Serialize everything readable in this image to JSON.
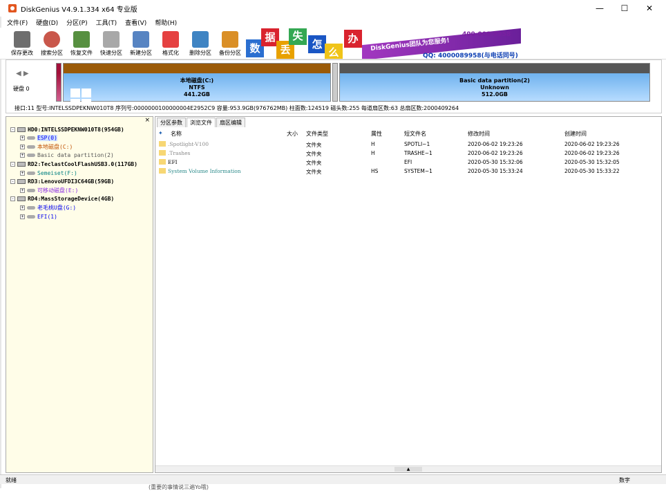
{
  "window": {
    "title": "DiskGenius V4.9.1.334 x64 专业版",
    "minimize": "—",
    "maximize": "☐",
    "close": "✕"
  },
  "menu": [
    "文件(F)",
    "硬盘(D)",
    "分区(P)",
    "工具(T)",
    "查看(V)",
    "帮助(H)"
  ],
  "toolbar": [
    {
      "label": "保存更改",
      "icon": "save-icon",
      "color": "#555"
    },
    {
      "label": "搜索分区",
      "icon": "search-icon",
      "color": "#c0392b"
    },
    {
      "label": "恢复文件",
      "icon": "recover-file-icon",
      "color": "#3a7d1e"
    },
    {
      "label": "快速分区",
      "icon": "quick-partition-icon",
      "color": "#999"
    },
    {
      "label": "新建分区",
      "icon": "new-partition-icon",
      "color": "#3a6fb7"
    },
    {
      "label": "格式化",
      "icon": "format-icon",
      "color": "#e02020"
    },
    {
      "label": "删除分区",
      "icon": "delete-partition-icon",
      "color": "#1d6fb8"
    },
    {
      "label": "备份分区",
      "icon": "backup-partition-icon",
      "color": "#d47b00"
    }
  ],
  "banner": {
    "chars": [
      {
        "c": "数",
        "bg": "#2b6fd0"
      },
      {
        "c": "据",
        "bg": "#d9232e"
      },
      {
        "c": "丢",
        "bg": "#e8a100"
      },
      {
        "c": "失",
        "bg": "#34a853"
      },
      {
        "c": "怎",
        "bg": "#1a56c4"
      },
      {
        "c": "么",
        "bg": "#f0c419"
      },
      {
        "c": "办",
        "bg": "#d9232e"
      }
    ],
    "slogan": "DiskGenius团队为您服务!",
    "phone": "400-008-9958",
    "qq": "QQ: 4000089958(与电话同号)"
  },
  "disk": {
    "nav_left": "◀",
    "nav_right": "▶",
    "label": "硬盘 0",
    "partitions": [
      {
        "name": "本地磁盘(C:)",
        "fs": "NTFS",
        "size": "441.2GB"
      },
      {
        "name": "Basic data partition(2)",
        "fs": "Unknown",
        "size": "512.0GB"
      }
    ],
    "info": "接口:11   型号:INTELSSDPEKNW010T8   序列号:0000000100000004E2952C9   容量:953.9GB(976762MB)   柱面数:124519   磁头数:255   每道扇区数:63   总扇区数:2000409264"
  },
  "tree": {
    "close": "×",
    "rows": [
      {
        "text": "HD0:INTELSSDPEKNW010T8(954GB)",
        "type": "disk",
        "level": 0,
        "color": "#000",
        "exp": "-"
      },
      {
        "text": "ESP(0)",
        "type": "part",
        "level": 1,
        "color": "#0000ee",
        "bg": "#cfe0ff",
        "exp": "+"
      },
      {
        "text": "本地磁盘(C:)",
        "type": "part",
        "level": 1,
        "color": "#c05000",
        "exp": "+"
      },
      {
        "text": "Basic data partition(2)",
        "type": "part",
        "level": 1,
        "color": "#555",
        "exp": "+"
      },
      {
        "text": "RD2:TeclastCoolFlashUSB3.0(117GB)",
        "type": "disk",
        "level": 0,
        "color": "#000",
        "exp": "-"
      },
      {
        "text": "Semeiset(F:)",
        "type": "part",
        "level": 1,
        "color": "#008080",
        "exp": "+"
      },
      {
        "text": "RD3:LenovoUFDI3C64GB(59GB)",
        "type": "disk",
        "level": 0,
        "color": "#000",
        "exp": "-"
      },
      {
        "text": "可移动磁盘(E:)",
        "type": "part",
        "level": 1,
        "color": "#8a2be2",
        "exp": "+"
      },
      {
        "text": "RD4:MassStorageDevice(4GB)",
        "type": "disk",
        "level": 0,
        "color": "#000",
        "exp": "-"
      },
      {
        "text": "老毛桃U盘(G:)",
        "type": "part",
        "level": 1,
        "color": "#0000ee",
        "exp": "+"
      },
      {
        "text": "EFI(1)",
        "type": "part",
        "level": 1,
        "color": "#0000ee",
        "exp": "+"
      }
    ]
  },
  "tabs": [
    "分区参数",
    "浏览文件",
    "扇区编辑"
  ],
  "file_columns": [
    "名称",
    "大小",
    "文件类型",
    "属性",
    "短文件名",
    "修改时间",
    "创建时间"
  ],
  "files": [
    {
      "name": ".Spotlight-V100",
      "size": "",
      "type": "文件夹",
      "attr": "H",
      "short": "SPOTLI~1",
      "mtime": "2020-06-02 19:23:26",
      "ctime": "2020-06-02 19:23:26",
      "color": "#888"
    },
    {
      "name": ".Trashes",
      "size": "",
      "type": "文件夹",
      "attr": "H",
      "short": "TRASHE~1",
      "mtime": "2020-06-02 19:23:26",
      "ctime": "2020-06-02 19:23:26",
      "color": "#888"
    },
    {
      "name": "EFI",
      "size": "",
      "type": "文件夹",
      "attr": "",
      "short": "EFI",
      "mtime": "2020-05-30 15:32:06",
      "ctime": "2020-05-30 15:32:05",
      "color": "#000"
    },
    {
      "name": "System Volume Information",
      "size": "",
      "type": "文件夹",
      "attr": "HS",
      "short": "SYSTEM~1",
      "mtime": "2020-05-30 15:33:24",
      "ctime": "2020-05-30 15:33:22",
      "color": "#2a8a8a"
    }
  ],
  "status": {
    "left": "就绪",
    "right": "数字"
  },
  "bottom_text": "(重要的事情说三遍Yo哦)"
}
